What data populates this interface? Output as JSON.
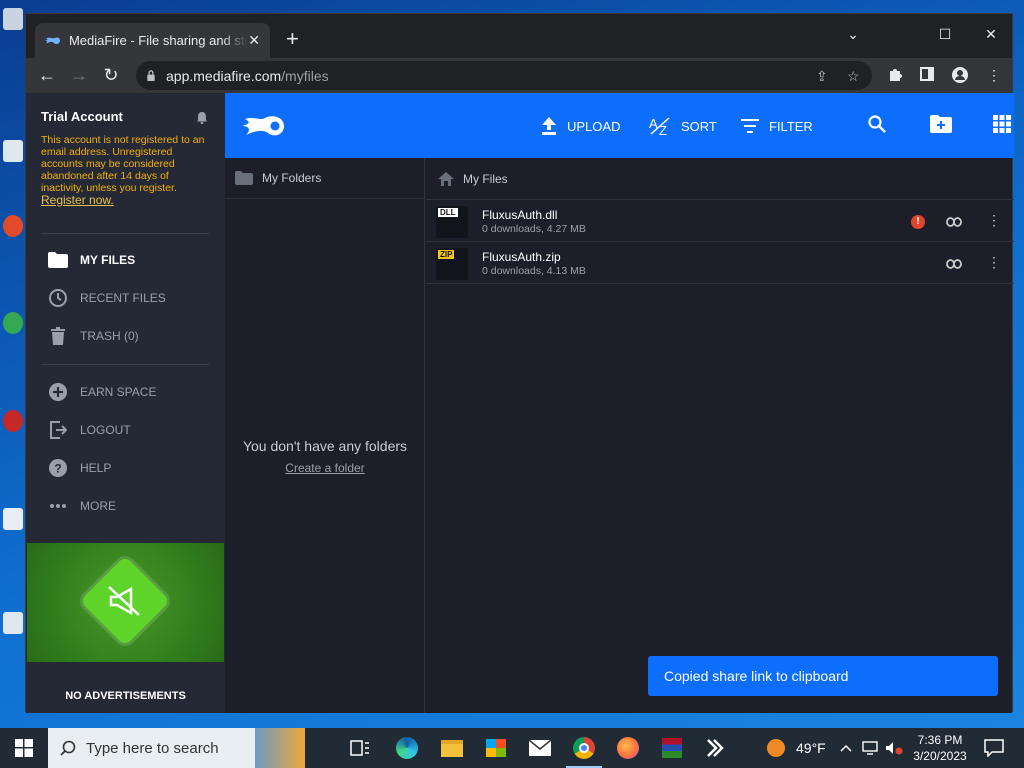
{
  "browser": {
    "tab_title": "MediaFire - File sharing and storage",
    "new_tab": "+",
    "url_host": "app.mediafire.com",
    "url_path": "/myfiles"
  },
  "sidebar": {
    "account_title": "Trial Account",
    "warning_text": "This account is not registered to an email address. Unregistered accounts may be considered abandoned after 14 days of inactivity, unless you register.",
    "register_link": "Register now.",
    "items": [
      {
        "label": "MY FILES",
        "icon": "folder-icon"
      },
      {
        "label": "RECENT FILES",
        "icon": "clock-icon"
      },
      {
        "label": "TRASH (0)",
        "icon": "trash-icon"
      },
      {
        "label": "EARN SPACE",
        "icon": "plus-circle-icon"
      },
      {
        "label": "LOGOUT",
        "icon": "logout-icon"
      },
      {
        "label": "HELP",
        "icon": "help-icon"
      },
      {
        "label": "MORE",
        "icon": "more-icon"
      }
    ],
    "promo_label": "NO ADVERTISEMENTS"
  },
  "topbar": {
    "upload": "UPLOAD",
    "sort": "SORT",
    "filter": "FILTER"
  },
  "folders": {
    "header": "My Folders",
    "empty_text": "You don't have any folders",
    "create_link": "Create a folder"
  },
  "files": {
    "header": "My Files",
    "rows": [
      {
        "name": "FluxusAuth.dll",
        "meta": "0 downloads, 4.27 MB",
        "tag": "DLL",
        "alert": true
      },
      {
        "name": "FluxusAuth.zip",
        "meta": "0 downloads, 4.13 MB",
        "tag": "ZIP",
        "alert": false
      }
    ]
  },
  "toast": "Copied share link to clipboard",
  "taskbar": {
    "search_placeholder": "Type here to search",
    "temperature": "49°F",
    "time": "7:36 PM",
    "date": "3/20/2023"
  },
  "colors": {
    "brand_blue": "#0d6efd",
    "warning": "#f2b100",
    "alert_red": "#e0452b"
  }
}
